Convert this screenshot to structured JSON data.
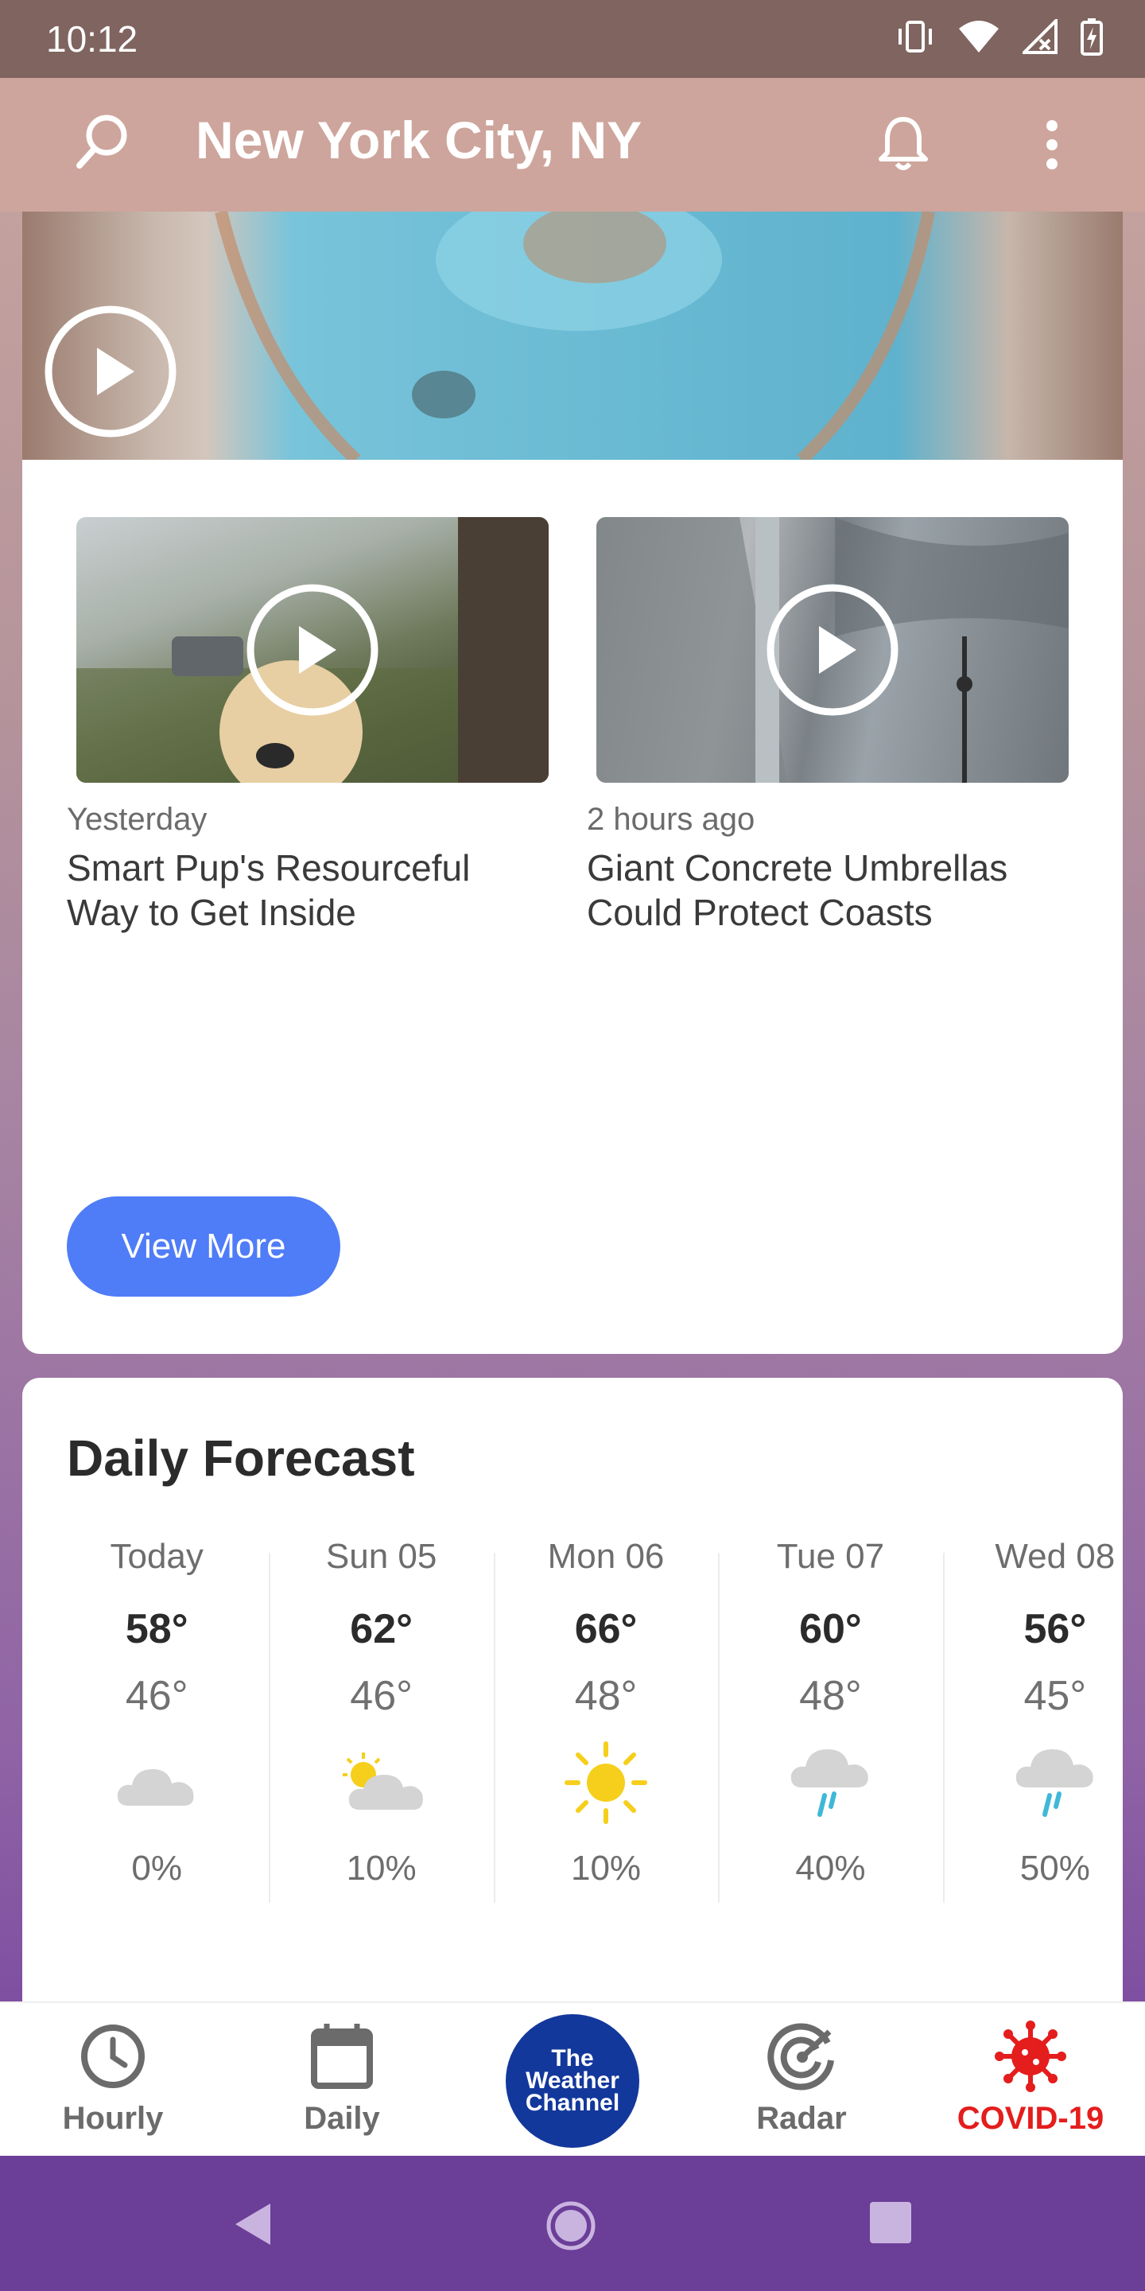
{
  "status_bar": {
    "time": "10:12",
    "icons": [
      "vibrate-icon",
      "wifi-icon",
      "cell-signal-icon",
      "battery-charging-icon"
    ]
  },
  "app_bar": {
    "city": "New York City, NY",
    "icons": [
      "search-icon",
      "bell-icon",
      "more-vert-icon"
    ]
  },
  "videos": [
    {
      "time": "Yesterday",
      "title": "Smart Pup's Resourceful Way to Get Inside"
    },
    {
      "time": "2 hours ago",
      "title": "Giant Concrete Umbrellas Could Protect Coasts"
    }
  ],
  "view_more": "View More",
  "forecast": {
    "title": "Daily Forecast",
    "days": [
      {
        "label": "Today",
        "high": "58°",
        "low": "46°",
        "icon": "cloudy-icon",
        "precip": "0%"
      },
      {
        "label": "Sun 05",
        "high": "62°",
        "low": "46°",
        "icon": "partly-cloudy-icon",
        "precip": "10%"
      },
      {
        "label": "Mon 06",
        "high": "66°",
        "low": "48°",
        "icon": "sunny-icon",
        "precip": "10%"
      },
      {
        "label": "Tue 07",
        "high": "60°",
        "low": "48°",
        "icon": "rain-icon",
        "precip": "40%"
      },
      {
        "label": "Wed 08",
        "high": "56°",
        "low": "45°",
        "icon": "rain-icon",
        "precip": "50%"
      }
    ]
  },
  "bottom_nav": {
    "hourly": "Hourly",
    "daily": "Daily",
    "logo": {
      "line1": "The",
      "line2": "Weather",
      "line3": "Channel"
    },
    "radar": "Radar",
    "covid": "COVID-19"
  },
  "colors": {
    "accent": "#4f7cf7",
    "logo": "#13389c",
    "covid": "#e41d1d",
    "app_bar": "#cda59c"
  }
}
